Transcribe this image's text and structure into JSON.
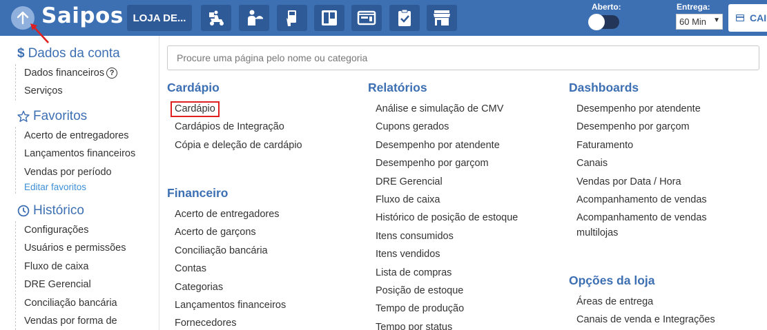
{
  "app": {
    "logo": "Saipos",
    "store_button": "LOJA DE..."
  },
  "topbar": {
    "icons": [
      "up-arrow-icon",
      "delivery-scooter-icon",
      "waiter-icon",
      "tablet-order-icon",
      "kanban-board-icon",
      "panel-layout-icon",
      "clipboard-check-icon",
      "store-icon"
    ],
    "aberto_label": "Aberto:",
    "entrega_label": "Entrega:",
    "entrega_value": "60 Min",
    "cart_label": "CAI"
  },
  "search": {
    "placeholder": "Procure uma página pelo nome ou categoria"
  },
  "sidebar": {
    "dados_title": "Dados da conta",
    "dados_items": [
      "Dados financeiros",
      "Serviços"
    ],
    "favoritos_title": "Favoritos",
    "favoritos_items": [
      "Acerto de entregadores",
      "Lançamentos financeiros",
      "Vendas por período"
    ],
    "edit_favorites": "Editar favoritos",
    "historico_title": "Histórico",
    "historico_items": [
      "Configurações",
      "Usuários e permissões",
      "Fluxo de caixa",
      "DRE Gerencial",
      "Conciliação bancária",
      "Vendas por forma de"
    ]
  },
  "main": {
    "cardapio": {
      "title": "Cardápio",
      "items": [
        "Cardápio",
        "Cardápios de Integração",
        "Cópia e deleção de cardápio"
      ]
    },
    "financeiro": {
      "title": "Financeiro",
      "items": [
        "Acerto de entregadores",
        "Acerto de garçons",
        "Conciliação bancária",
        "Contas",
        "Categorias",
        "Lançamentos financeiros",
        "Fornecedores"
      ]
    },
    "relatorios": {
      "title": "Relatórios",
      "items": [
        "Análise e simulação de CMV",
        "Cupons gerados",
        "Desempenho por atendente",
        "Desempenho por garçom",
        "DRE Gerencial",
        "Fluxo de caixa",
        "Histórico de posição de estoque",
        "Itens consumidos",
        "Itens vendidos",
        "Lista de compras",
        "Posição de estoque",
        "Tempo de produção",
        "Tempo por status"
      ]
    },
    "dashboards": {
      "title": "Dashboards",
      "items": [
        "Desempenho por atendente",
        "Desempenho por garçom",
        "Faturamento",
        "Canais",
        "Vendas por Data / Hora",
        "Acompanhamento de vendas",
        "Acompanhamento de vendas multilojas"
      ]
    },
    "opcoes": {
      "title": "Opções da loja",
      "items": [
        "Áreas de entrega",
        "Canais de venda e Integrações"
      ]
    }
  },
  "colors": {
    "brand": "#3d6fb3",
    "highlight": "#e02020",
    "link": "#3d8fd6"
  }
}
